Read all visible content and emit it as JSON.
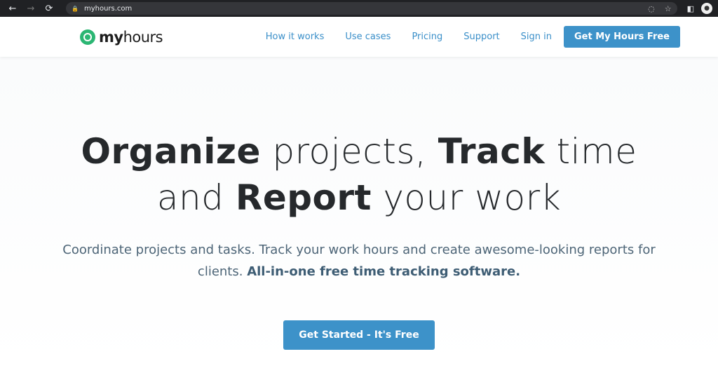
{
  "browser": {
    "url": "myhours.com",
    "back": "←",
    "forward": "→",
    "reload": "⟳"
  },
  "header": {
    "logo_bold": "my",
    "logo_rest": "hours",
    "nav": [
      "How it works",
      "Use cases",
      "Pricing",
      "Support",
      "Sign in"
    ],
    "cta": "Get My Hours Free"
  },
  "hero": {
    "t1": "Organize",
    "t2": " projects, ",
    "t3": "Track",
    "t4": " time",
    "t5": "and ",
    "t6": "Report",
    "t7": " your work",
    "sub": "Coordinate projects and tasks. Track your work hours and create awesome-looking reports for clients. ",
    "sub_bold": "All-in-one free time tracking software.",
    "button": "Get Started - It's Free"
  },
  "colors": {
    "accent": "#3d92c9",
    "logo_green": "#2bb673"
  }
}
